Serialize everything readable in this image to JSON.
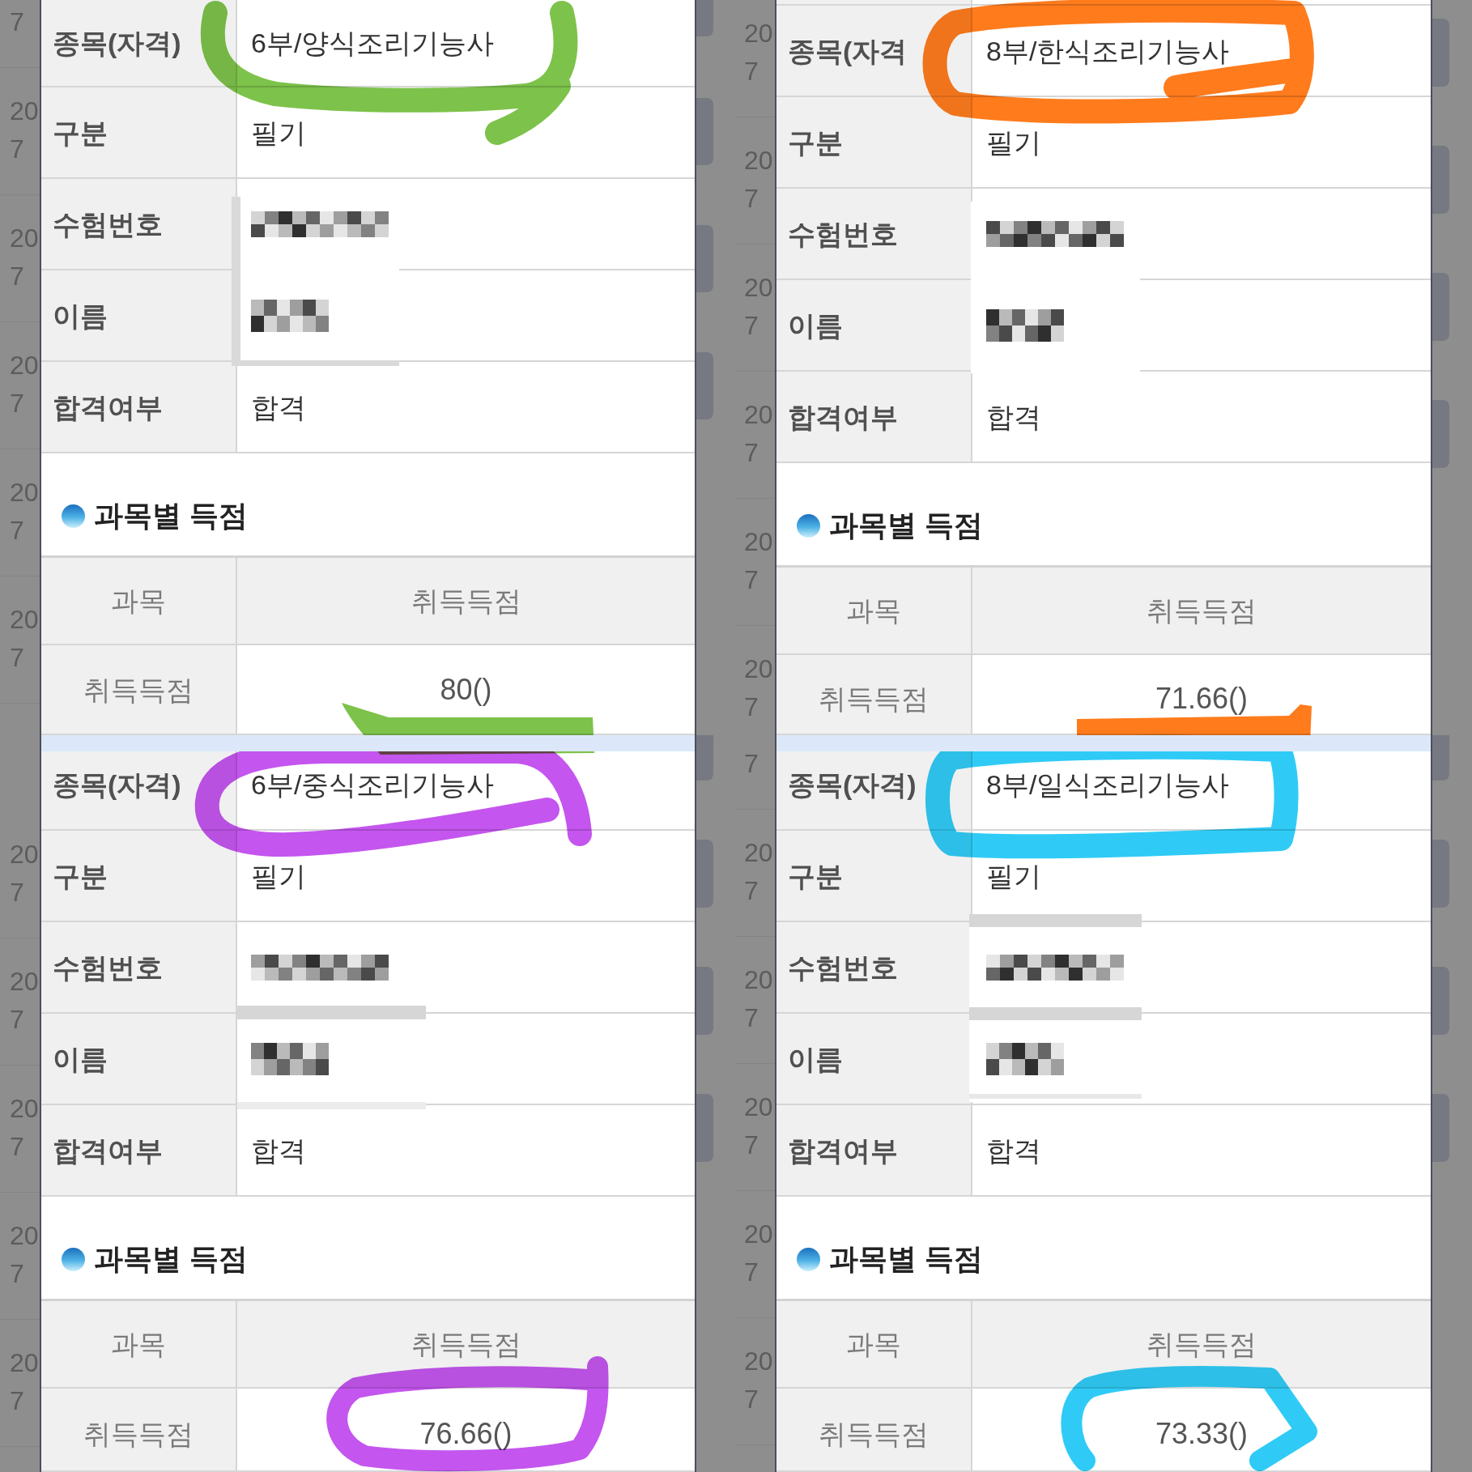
{
  "screenshots": [
    {
      "color": "#7dc24a",
      "info_rows": [
        {
          "label": "종목(자격)",
          "value": "6부/양식조리기능사",
          "redacted": false
        },
        {
          "label": "구분",
          "value": "필기",
          "redacted": false
        },
        {
          "label": "수험번호",
          "redacted": true
        },
        {
          "label": "이름",
          "redacted": true
        },
        {
          "label": "합격여부",
          "value": "합격",
          "redacted": false
        }
      ],
      "section_title": "과목별 득점",
      "score_table": {
        "columns": [
          "과목",
          "취득득점"
        ],
        "rows": [
          {
            "subject": "취득득점",
            "score": "80()"
          }
        ]
      }
    },
    {
      "color": "#ff7b1c",
      "info_rows": [
        {
          "label": "종목(자격",
          "value": "8부/한식조리기능사",
          "redacted": false
        },
        {
          "label": "구분",
          "value": "필기",
          "redacted": false
        },
        {
          "label": "수험번호",
          "redacted": true
        },
        {
          "label": "이름",
          "redacted": true
        },
        {
          "label": "합격여부",
          "value": "합격",
          "redacted": false
        }
      ],
      "section_title": "과목별 득점",
      "score_table": {
        "columns": [
          "과목",
          "취득득점"
        ],
        "rows": [
          {
            "subject": "취득득점",
            "score": "71.66()"
          }
        ]
      }
    },
    {
      "color": "#c455ee",
      "info_rows": [
        {
          "label": "종목(자격)",
          "value": "6부/중식조리기능사",
          "redacted": false
        },
        {
          "label": "구분",
          "value": "필기",
          "redacted": false
        },
        {
          "label": "수험번호",
          "redacted": true
        },
        {
          "label": "이름",
          "redacted": true
        },
        {
          "label": "합격여부",
          "value": "합격",
          "redacted": false
        }
      ],
      "section_title": "과목별 득점",
      "score_table": {
        "columns": [
          "과목",
          "취득득점"
        ],
        "rows": [
          {
            "subject": "취득득점",
            "score": "76.66()"
          }
        ]
      }
    },
    {
      "color": "#2fcbf6",
      "info_rows": [
        {
          "label": "종목(자격)",
          "value": "8부/일식조리기능사",
          "redacted": false
        },
        {
          "label": "구분",
          "value": "필기",
          "redacted": false
        },
        {
          "label": "수험번호",
          "redacted": true
        },
        {
          "label": "이름",
          "redacted": true
        },
        {
          "label": "합격여부",
          "value": "합격",
          "redacted": false
        }
      ],
      "section_title": "과목별 득점",
      "score_table": {
        "columns": [
          "과목",
          "취득득점"
        ],
        "rows": [
          {
            "subject": "취득득점",
            "score": "73.33()"
          }
        ]
      }
    }
  ],
  "background_page": {
    "left_edge": {
      "upper": [
        {
          "line_2": "7"
        },
        {
          "line_1": "20",
          "line_2": "7"
        },
        {
          "line_1": "20",
          "line_2": "7"
        },
        {
          "line_1": "20",
          "line_2": "7"
        },
        {
          "line_1": "20",
          "line_2": "7"
        },
        {
          "line_1": "20",
          "line_2": "7"
        }
      ],
      "lower": [
        {
          "line_1": "20",
          "line_2": "7"
        },
        {
          "line_1": "20",
          "line_2": "7"
        },
        {
          "line_1": "20",
          "line_2": "7"
        },
        {
          "line_1": "20",
          "line_2": "7"
        },
        {
          "line_1": "20",
          "line_2": "7"
        }
      ]
    },
    "middle_edge": {
      "upper": [
        {
          "line_1": "20",
          "line_2": "7"
        },
        {
          "line_1": "20",
          "line_2": "7"
        },
        {
          "line_1": "20",
          "line_2": "7"
        },
        {
          "line_1": "20",
          "line_2": "7"
        },
        {
          "line_1": "20",
          "line_2": "7"
        },
        {
          "line_1": "20",
          "line_2": "7"
        }
      ],
      "lower": [
        {
          "line_2": "7"
        },
        {
          "line_1": "20",
          "line_2": "7"
        },
        {
          "line_1": "20",
          "line_2": "7"
        },
        {
          "line_1": "20",
          "line_2": "7"
        },
        {
          "line_1": "20",
          "line_2": "7"
        },
        {
          "line_1": "20",
          "line_2": "7"
        }
      ]
    }
  }
}
